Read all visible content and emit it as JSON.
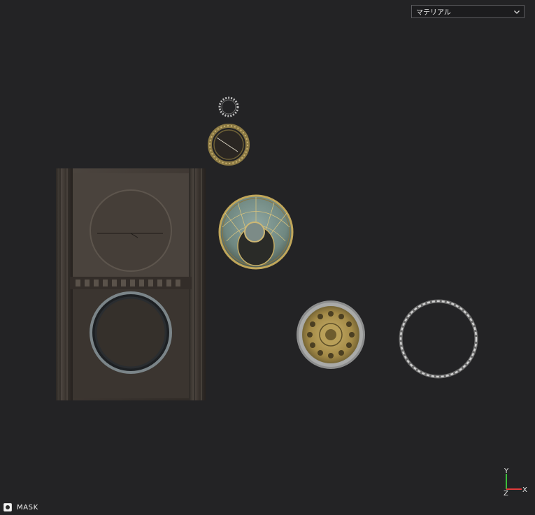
{
  "toolbar": {
    "material_dropdown": {
      "selected": "マテリアル",
      "icon": "chevron-down-icon"
    }
  },
  "bottom_bar": {
    "mask_toggle_label": "MASK",
    "mask_icon": "radio-toggle-icon"
  },
  "axis_gizmo": {
    "x_label": "X",
    "y_label": "Y",
    "z_label": "Z",
    "colors": {
      "x": "#e23b3b",
      "y": "#3bbf3b",
      "z": "#e8e8e8"
    }
  },
  "colors": {
    "background": "#232325",
    "stone": "#4a423b",
    "brass": "#b39a55",
    "silver": "#c9c9c9"
  }
}
